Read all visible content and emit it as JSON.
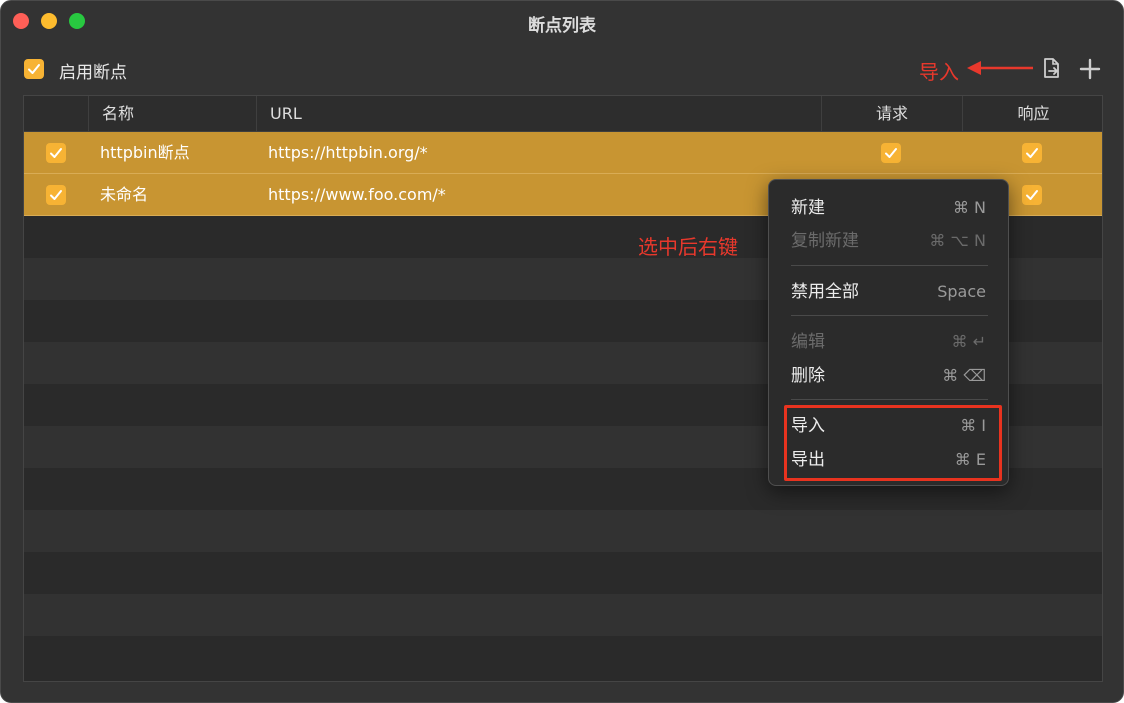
{
  "window": {
    "title": "断点列表"
  },
  "toolbar": {
    "enable_label": "启用断点",
    "enabled": true
  },
  "annotations": {
    "import_label": "导入",
    "select_hint": "选中后右键",
    "color": "#e8382c"
  },
  "icons": {
    "import": "import-file-icon",
    "add": "plus-icon",
    "check": "checkmark-icon"
  },
  "table": {
    "columns": [
      "",
      "名称",
      "URL",
      "请求",
      "响应"
    ],
    "rows": [
      {
        "enabled": true,
        "name": "httpbin断点",
        "url": "https://httpbin.org/*",
        "request": true,
        "response": true
      },
      {
        "enabled": true,
        "name": "未命名",
        "url": "https://www.foo.com/*",
        "request": true,
        "response": true
      }
    ]
  },
  "context_menu": {
    "items": [
      {
        "label": "新建",
        "shortcut": "⌘ N",
        "enabled": true
      },
      {
        "label": "复制新建",
        "shortcut": "⌘ ⌥ N",
        "enabled": false
      },
      {
        "label": "禁用全部",
        "shortcut": "Space",
        "enabled": true
      },
      {
        "label": "编辑",
        "shortcut": "⌘ ↵",
        "enabled": false
      },
      {
        "label": "删除",
        "shortcut": "⌘ ⌫",
        "enabled": true
      },
      {
        "label": "导入",
        "shortcut": "⌘ I",
        "enabled": true
      },
      {
        "label": "导出",
        "shortcut": "⌘ E",
        "enabled": true
      }
    ]
  },
  "colors": {
    "accent": "#f7b334",
    "selected_row": "#c89532",
    "window_bg": "#333333"
  }
}
